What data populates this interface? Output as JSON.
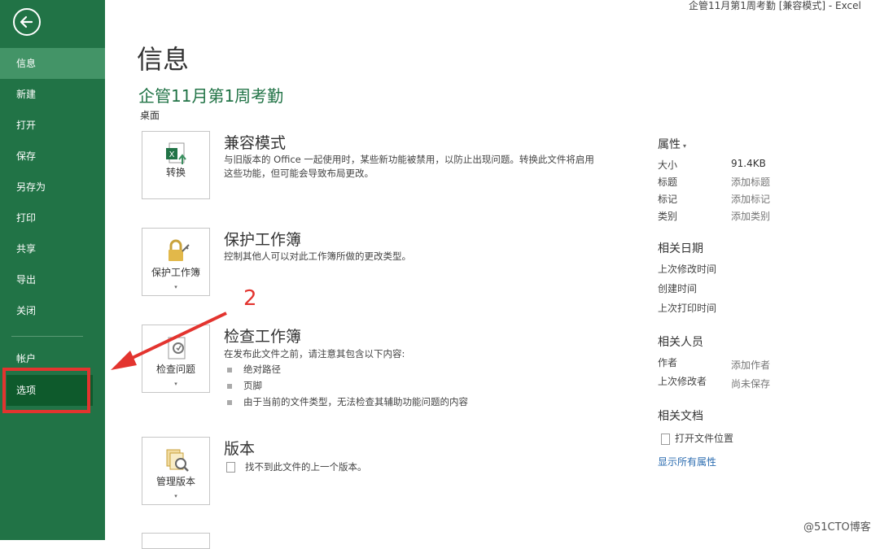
{
  "window": {
    "title": "企管11月第1周考勤  [兼容模式] - Excel"
  },
  "sidebar": {
    "items": [
      {
        "label": "信息"
      },
      {
        "label": "新建"
      },
      {
        "label": "打开"
      },
      {
        "label": "保存"
      },
      {
        "label": "另存为"
      },
      {
        "label": "打印"
      },
      {
        "label": "共享"
      },
      {
        "label": "导出"
      },
      {
        "label": "关闭"
      }
    ],
    "account": "帐户",
    "options": "选项"
  },
  "main": {
    "title": "信息",
    "doc_name": "企管11月第1周考勤",
    "doc_path": "桌面",
    "sections": {
      "compat": {
        "button": "转换",
        "title": "兼容模式",
        "desc": "与旧版本的 Office 一起使用时，某些新功能被禁用，以防止出现问题。转换此文件将启用这些功能，但可能会导致布局更改。"
      },
      "protect": {
        "button": "保护工作簿",
        "title": "保护工作簿",
        "desc": "控制其他人可以对此工作簿所做的更改类型。"
      },
      "inspect": {
        "button": "检查问题",
        "title": "检查工作簿",
        "desc": "在发布此文件之前，请注意其包含以下内容:",
        "bullets": [
          "绝对路径",
          "页脚",
          "由于当前的文件类型，无法检查其辅助功能问题的内容"
        ]
      },
      "versions": {
        "button": "管理版本",
        "title": "版本",
        "desc": "找不到此文件的上一个版本。"
      }
    },
    "annotation": "2"
  },
  "properties": {
    "header": "属性",
    "rows": [
      {
        "k": "大小",
        "v": "91.4KB"
      },
      {
        "k": "标题",
        "v": "添加标题"
      },
      {
        "k": "标记",
        "v": "添加标记"
      },
      {
        "k": "类别",
        "v": "添加类别"
      }
    ],
    "dates_header": "相关日期",
    "dates": [
      "上次修改时间",
      "创建时间",
      "上次打印时间"
    ],
    "people_header": "相关人员",
    "author_k": "作者",
    "author_v": "添加作者",
    "modifier_k": "上次修改者",
    "modifier_v": "尚未保存",
    "docs_header": "相关文档",
    "open_location": "打开文件位置",
    "show_all": "显示所有属性"
  },
  "watermark": "@51CTO博客",
  "colors": {
    "sidebar": "#217346",
    "accent": "#217346",
    "annotation": "#e3342f"
  }
}
